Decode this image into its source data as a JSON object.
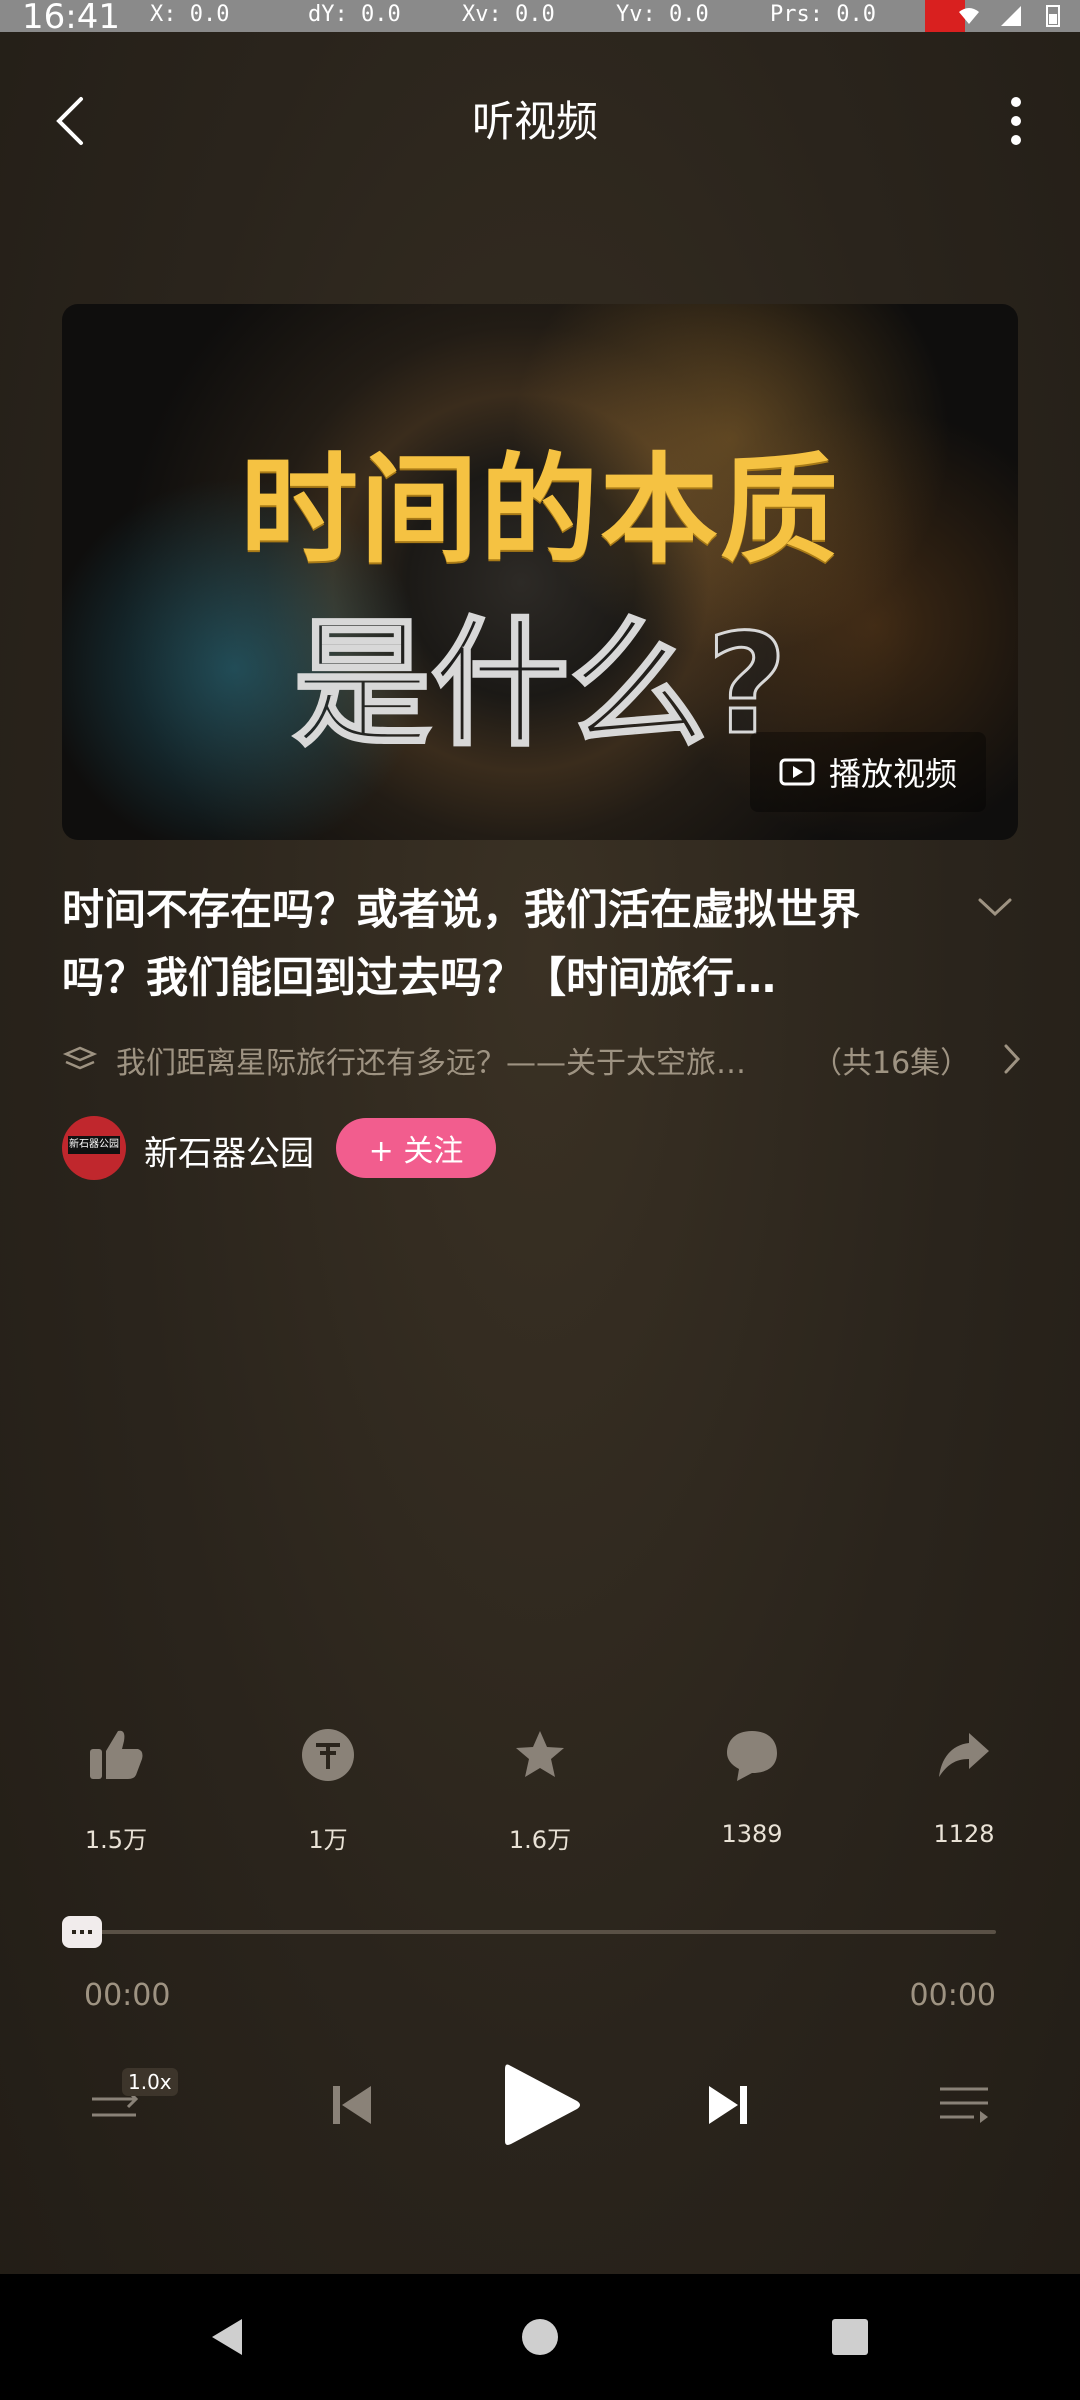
{
  "status_bar": {
    "time": "16:41",
    "debug": [
      "X: 0.0",
      "dY: 0.0",
      "Xv: 0.0",
      "Yv: 0.0",
      "Prs: 0.0"
    ]
  },
  "header": {
    "title": "听视频",
    "back_icon": "chevron-left-icon",
    "more_icon": "more-vertical-icon"
  },
  "hero": {
    "line1": "时间的本质",
    "line2": "是什么?",
    "play_video_label": "播放视频"
  },
  "video": {
    "title": "时间不存在吗？或者说，我们活在虚拟世界吗？我们能回到过去吗？【时间旅行…",
    "collection": "我们距离星际旅行还有多远？——关于太空旅…",
    "collection_count": "（共16集）"
  },
  "author": {
    "name": "新石器公园",
    "avatar_text": "新石器公园",
    "follow_label": "+ 关注"
  },
  "actions": [
    {
      "name": "like",
      "icon": "thumbs-up-icon",
      "count": "1.5万"
    },
    {
      "name": "coin",
      "icon": "coin-icon",
      "count": "1万"
    },
    {
      "name": "favorite",
      "icon": "star-icon",
      "count": "1.6万"
    },
    {
      "name": "comment",
      "icon": "comment-icon",
      "count": "1389"
    },
    {
      "name": "share",
      "icon": "share-icon",
      "count": "1128"
    }
  ],
  "player": {
    "current_time": "00:00",
    "total_time": "00:00",
    "speed": "1.0x",
    "progress": 0
  },
  "colors": {
    "background": "#2a241c",
    "accent_pink": "#f25d8e",
    "title_yellow": "#f5c242",
    "muted_text": "#9e9382"
  }
}
